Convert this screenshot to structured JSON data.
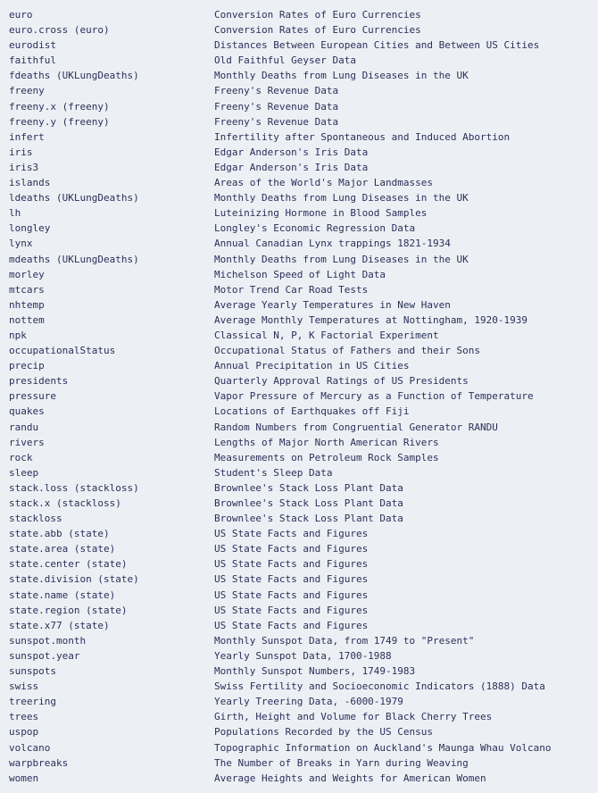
{
  "datasets": [
    {
      "name": "euro",
      "desc": "Conversion Rates of Euro Currencies"
    },
    {
      "name": "euro.cross (euro)",
      "desc": "Conversion Rates of Euro Currencies"
    },
    {
      "name": "eurodist",
      "desc": "Distances Between European Cities and Between US Cities"
    },
    {
      "name": "faithful",
      "desc": "Old Faithful Geyser Data"
    },
    {
      "name": "fdeaths (UKLungDeaths)",
      "desc": "Monthly Deaths from Lung Diseases in the UK"
    },
    {
      "name": "freeny",
      "desc": "Freeny's Revenue Data"
    },
    {
      "name": "freeny.x (freeny)",
      "desc": "Freeny's Revenue Data"
    },
    {
      "name": "freeny.y (freeny)",
      "desc": "Freeny's Revenue Data"
    },
    {
      "name": "infert",
      "desc": "Infertility after Spontaneous and Induced Abortion"
    },
    {
      "name": "iris",
      "desc": "Edgar Anderson's Iris Data"
    },
    {
      "name": "iris3",
      "desc": "Edgar Anderson's Iris Data"
    },
    {
      "name": "islands",
      "desc": "Areas of the World's Major Landmasses"
    },
    {
      "name": "ldeaths (UKLungDeaths)",
      "desc": "Monthly Deaths from Lung Diseases in the UK"
    },
    {
      "name": "lh",
      "desc": "Luteinizing Hormone in Blood Samples"
    },
    {
      "name": "longley",
      "desc": "Longley's Economic Regression Data"
    },
    {
      "name": "lynx",
      "desc": "Annual Canadian Lynx trappings 1821-1934"
    },
    {
      "name": "mdeaths (UKLungDeaths)",
      "desc": "Monthly Deaths from Lung Diseases in the UK"
    },
    {
      "name": "morley",
      "desc": "Michelson Speed of Light Data"
    },
    {
      "name": "mtcars",
      "desc": "Motor Trend Car Road Tests"
    },
    {
      "name": "nhtemp",
      "desc": "Average Yearly Temperatures in New Haven"
    },
    {
      "name": "nottem",
      "desc": "Average Monthly Temperatures at Nottingham, 1920-1939"
    },
    {
      "name": "npk",
      "desc": "Classical N, P, K Factorial Experiment"
    },
    {
      "name": "occupationalStatus",
      "desc": "Occupational Status of Fathers and their Sons"
    },
    {
      "name": "precip",
      "desc": "Annual Precipitation in US Cities"
    },
    {
      "name": "presidents",
      "desc": "Quarterly Approval Ratings of US Presidents"
    },
    {
      "name": "pressure",
      "desc": "Vapor Pressure of Mercury as a Function of Temperature"
    },
    {
      "name": "quakes",
      "desc": "Locations of Earthquakes off Fiji"
    },
    {
      "name": "randu",
      "desc": "Random Numbers from Congruential Generator RANDU"
    },
    {
      "name": "rivers",
      "desc": "Lengths of Major North American Rivers"
    },
    {
      "name": "rock",
      "desc": "Measurements on Petroleum Rock Samples"
    },
    {
      "name": "sleep",
      "desc": "Student's Sleep Data"
    },
    {
      "name": "stack.loss (stackloss)",
      "desc": "Brownlee's Stack Loss Plant Data"
    },
    {
      "name": "stack.x (stackloss)",
      "desc": "Brownlee's Stack Loss Plant Data"
    },
    {
      "name": "stackloss",
      "desc": "Brownlee's Stack Loss Plant Data"
    },
    {
      "name": "state.abb (state)",
      "desc": "US State Facts and Figures"
    },
    {
      "name": "state.area (state)",
      "desc": "US State Facts and Figures"
    },
    {
      "name": "state.center (state)",
      "desc": "US State Facts and Figures"
    },
    {
      "name": "state.division (state)",
      "desc": "US State Facts and Figures"
    },
    {
      "name": "state.name (state)",
      "desc": "US State Facts and Figures"
    },
    {
      "name": "state.region (state)",
      "desc": "US State Facts and Figures"
    },
    {
      "name": "state.x77 (state)",
      "desc": "US State Facts and Figures"
    },
    {
      "name": "sunspot.month",
      "desc": "Monthly Sunspot Data, from 1749 to \"Present\""
    },
    {
      "name": "sunspot.year",
      "desc": "Yearly Sunspot Data, 1700-1988"
    },
    {
      "name": "sunspots",
      "desc": "Monthly Sunspot Numbers, 1749-1983"
    },
    {
      "name": "swiss",
      "desc": "Swiss Fertility and Socioeconomic Indicators (1888) Data"
    },
    {
      "name": "treering",
      "desc": "Yearly Treering Data, -6000-1979"
    },
    {
      "name": "trees",
      "desc": "Girth, Height and Volume for Black Cherry Trees"
    },
    {
      "name": "uspop",
      "desc": "Populations Recorded by the US Census"
    },
    {
      "name": "volcano",
      "desc": "Topographic Information on Auckland's Maunga Whau Volcano"
    },
    {
      "name": "warpbreaks",
      "desc": "The Number of Breaks in Yarn during Weaving"
    },
    {
      "name": "women",
      "desc": "Average Heights and Weights for American Women"
    }
  ]
}
